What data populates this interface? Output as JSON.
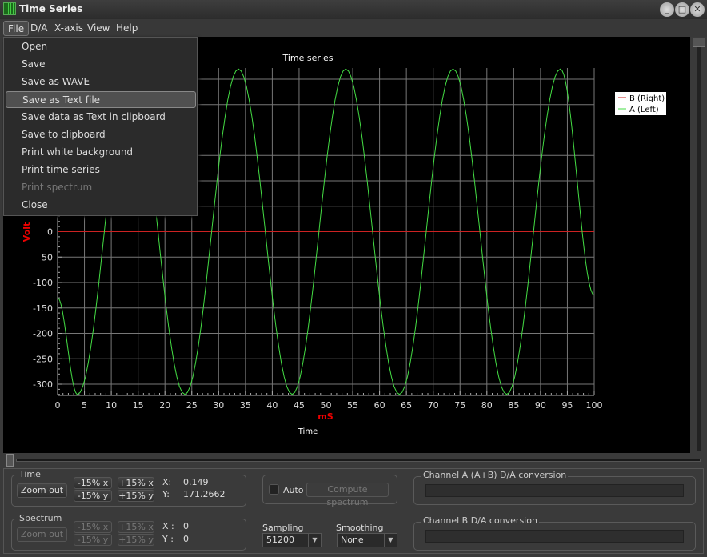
{
  "window": {
    "title": "Time Series"
  },
  "menubar": [
    "File",
    "D/A",
    "X-axis",
    "View",
    "Help"
  ],
  "file_menu": [
    {
      "label": "Open",
      "enabled": true
    },
    {
      "label": "Save",
      "enabled": true
    },
    {
      "label": "Save as WAVE",
      "enabled": true
    },
    {
      "label": "Save as Text file",
      "enabled": true,
      "highlighted": true
    },
    {
      "label": "Save data as Text in clipboard",
      "enabled": true
    },
    {
      "label": "Save to clipboard",
      "enabled": true
    },
    {
      "label": "Print white background",
      "enabled": true
    },
    {
      "label": "Print time series",
      "enabled": true
    },
    {
      "label": "Print spectrum",
      "enabled": false
    },
    {
      "label": "Close",
      "enabled": true
    }
  ],
  "chart_data": {
    "type": "line",
    "title": "Time series",
    "xlabel": "Time",
    "xunit": "mS",
    "ylabel": "Volt",
    "xlim": [
      0,
      100
    ],
    "ylim": [
      -322,
      322
    ],
    "xticks": [
      0,
      5,
      10,
      15,
      20,
      25,
      30,
      35,
      40,
      45,
      50,
      55,
      60,
      65,
      70,
      75,
      80,
      85,
      90,
      95,
      100
    ],
    "yticks": [
      -300,
      -250,
      -200,
      -150,
      -100,
      -50,
      0
    ],
    "grid": true,
    "legend": "top-right",
    "series": [
      {
        "name": "B (Right)",
        "color": "#cc2222",
        "points": [
          [
            0,
            0
          ],
          [
            100,
            0
          ]
        ]
      },
      {
        "name": "A (Left)",
        "color": "#44dd44",
        "points": [
          [
            0,
            -130
          ],
          [
            3.7,
            -320
          ],
          [
            13.7,
            320
          ],
          [
            23.7,
            -320
          ],
          [
            33.7,
            320
          ],
          [
            43.7,
            -320
          ],
          [
            53.7,
            320
          ],
          [
            63.7,
            -320
          ],
          [
            73.7,
            320
          ],
          [
            83.7,
            -320
          ],
          [
            93.7,
            320
          ],
          [
            100,
            -125
          ]
        ]
      }
    ]
  },
  "time": {
    "label": "Time",
    "zoom_out": "Zoom out",
    "minus_x": "-15% x",
    "plus_x": "+15% x",
    "minus_y": "-15% y",
    "plus_y": "+15% y",
    "x_label": "X:",
    "x_value": "0.149",
    "y_label": "Y:",
    "y_value": "171.2662"
  },
  "spectrum": {
    "label": "Spectrum",
    "zoom_out": "Zoom out",
    "minus_x": "-15% x",
    "plus_x": "+15% x",
    "minus_y": "-15% y",
    "plus_y": "+15% y",
    "x_label": "X :",
    "x_value": "0",
    "y_label": "Y :",
    "y_value": "0"
  },
  "auto": {
    "label": "Auto",
    "checked": false,
    "compute": "Compute spectrum"
  },
  "sampling": {
    "label": "Sampling",
    "value": "51200"
  },
  "smoothing": {
    "label": "Smoothing",
    "value": "None"
  },
  "channel_a": {
    "label": "Channel A (A+B) D/A conversion",
    "progress": 0
  },
  "channel_b": {
    "label": "Channel B D/A conversion",
    "progress": 0
  }
}
